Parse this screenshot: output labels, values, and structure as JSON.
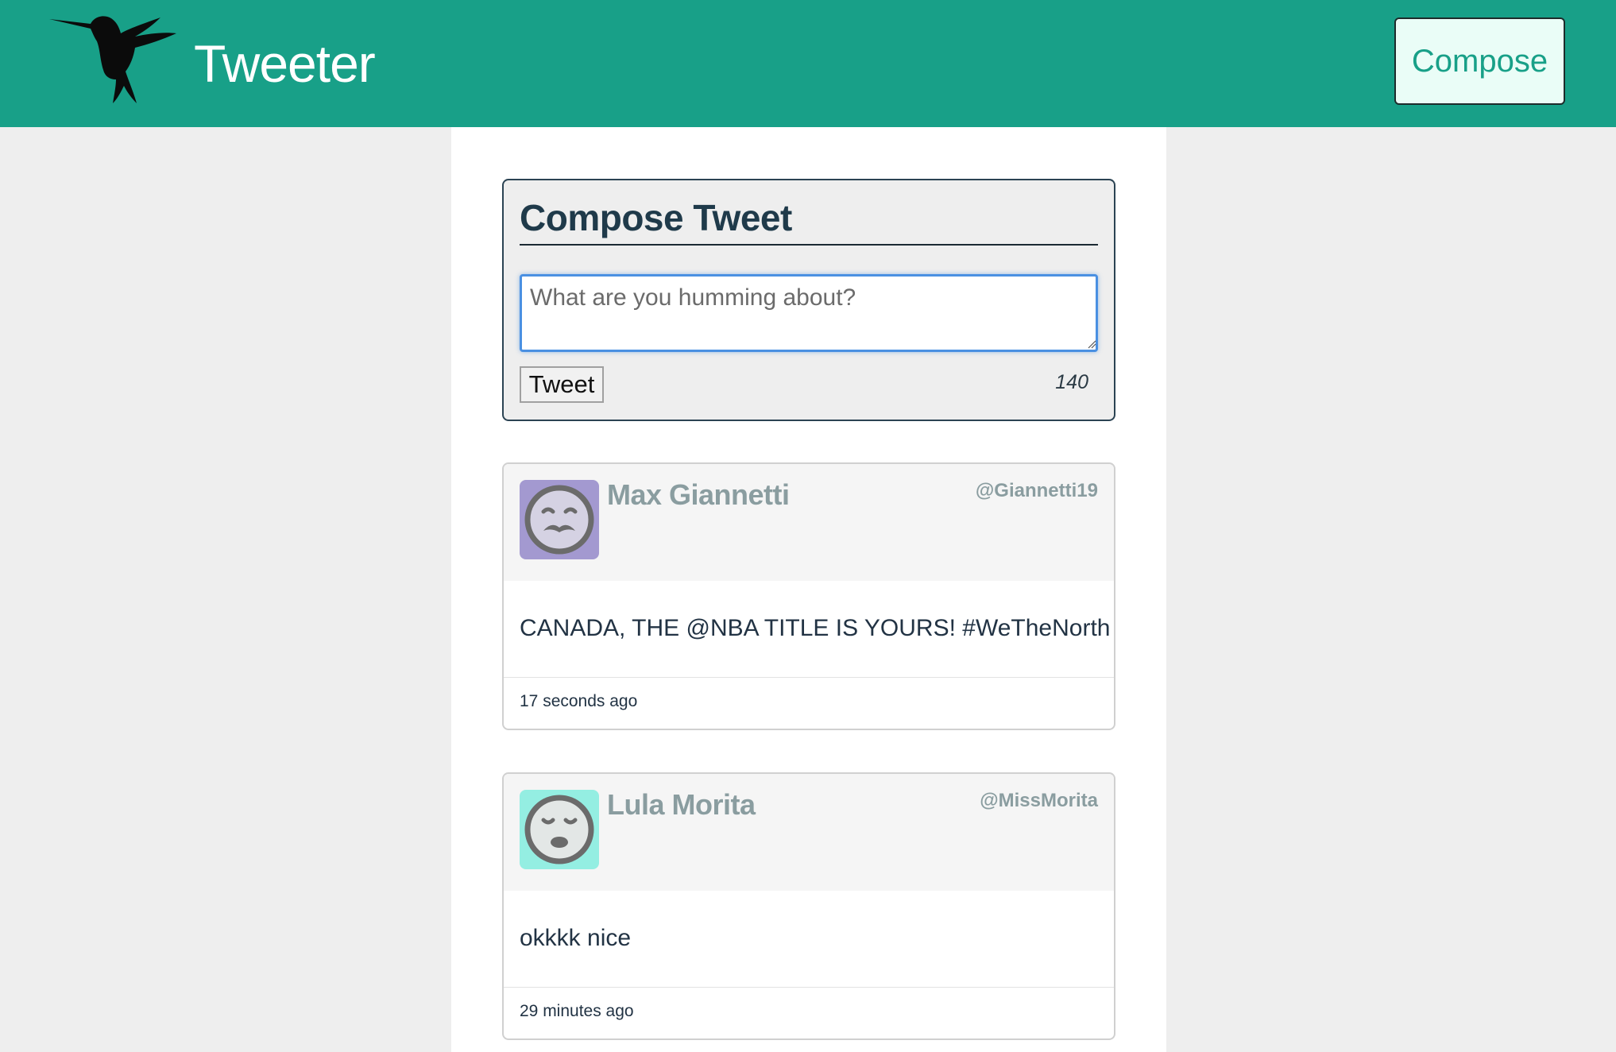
{
  "navbar": {
    "brand": "Tweeter",
    "compose_label": "Compose",
    "logo_icon": "hummingbird-icon",
    "background_color": "#18a088"
  },
  "composer": {
    "title": "Compose Tweet",
    "placeholder": "What are you humming about?",
    "value": "",
    "tweet_button_label": "Tweet",
    "char_counter": "140"
  },
  "tweets": [
    {
      "name": "Max Giannetti",
      "handle": "@Giannetti19",
      "content": "CANADA, THE @NBA TITLE IS YOURS! #WeTheNorth",
      "timestamp": "17 seconds ago",
      "avatar_icon": "mustache-face-icon",
      "avatar_color": "#a399d0"
    },
    {
      "name": "Lula Morita",
      "handle": "@MissMorita",
      "content": "okkkk nice",
      "timestamp": "29 minutes ago",
      "avatar_icon": "sleepy-face-icon",
      "avatar_color": "#94eee2"
    }
  ]
}
